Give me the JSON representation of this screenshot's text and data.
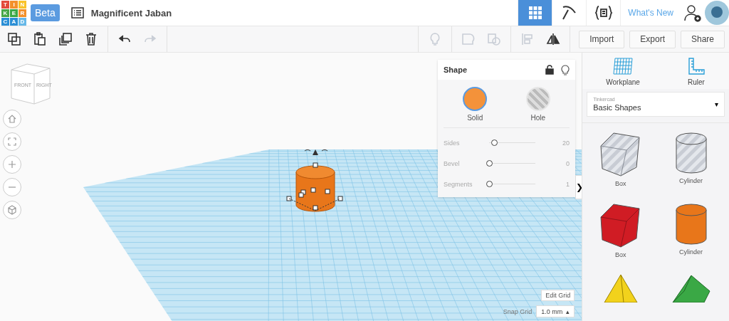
{
  "header": {
    "logo_letters": [
      "T",
      "I",
      "N",
      "K",
      "E",
      "R",
      "C",
      "A",
      "D"
    ],
    "badge": "Beta",
    "project_title": "Magnificent Jaban",
    "nav": [
      {
        "kind": "grid",
        "selected": true
      },
      {
        "kind": "pickaxe",
        "selected": false
      },
      {
        "kind": "code",
        "selected": false
      }
    ],
    "whats_new": "What's New"
  },
  "toolbar": {
    "left": [
      {
        "kind": "copy",
        "disabled": false
      },
      {
        "kind": "paste",
        "disabled": false
      },
      {
        "kind": "duplicate",
        "disabled": false
      },
      {
        "kind": "delete",
        "disabled": false
      },
      {
        "kind": "undo",
        "disabled": false
      },
      {
        "kind": "redo",
        "disabled": true
      }
    ],
    "right": [
      {
        "kind": "bulb",
        "disabled": true
      },
      {
        "kind": "group",
        "disabled": true
      },
      {
        "kind": "ungroup",
        "disabled": true
      },
      {
        "kind": "align",
        "disabled": true
      },
      {
        "kind": "mirror",
        "disabled": false
      }
    ],
    "buttons": [
      "Import",
      "Export",
      "Share"
    ]
  },
  "view_cube": {
    "front": "FRONT",
    "right": "RIGHT"
  },
  "view_controls": [
    {
      "kind": "home"
    },
    {
      "kind": "fit"
    },
    {
      "kind": "zoom-in"
    },
    {
      "kind": "zoom-out"
    },
    {
      "kind": "perspective"
    }
  ],
  "shape_panel": {
    "title": "Shape",
    "modes": [
      {
        "label": "Solid",
        "kind": "solid",
        "selected": true
      },
      {
        "label": "Hole",
        "kind": "hole",
        "selected": false
      }
    ],
    "sliders": [
      {
        "label": "Sides",
        "level": 0.1,
        "reading": "20"
      },
      {
        "label": "Bevel",
        "level": 0,
        "reading": "0"
      },
      {
        "label": "Segments",
        "level": 0,
        "reading": "1"
      }
    ],
    "collapse": "❯"
  },
  "grid_controls": {
    "edit_button": "Edit Grid",
    "snap_label": "Snap Grid",
    "snap_value": "1.0 mm",
    "snap_arrow": "▴"
  },
  "sidebar": {
    "tools": [
      {
        "kind": "workplane",
        "label": "Workplane"
      },
      {
        "kind": "ruler",
        "label": "Ruler"
      }
    ],
    "library": {
      "caption": "Tinkercad",
      "value": "Basic Shapes",
      "arrow": "▾"
    },
    "shapes": [
      {
        "kind": "box",
        "label": "Box",
        "color": "#c8ccd4",
        "hole": true
      },
      {
        "kind": "cylinder",
        "label": "Cylinder",
        "color": "#c8ccd4",
        "hole": true
      },
      {
        "kind": "box",
        "label": "Box",
        "color": "#d01c24",
        "hole": false
      },
      {
        "kind": "cylinder",
        "label": "Cylinder",
        "color": "#e8761a",
        "hole": false
      },
      {
        "kind": "pyramid",
        "color": "#f2d21c",
        "hole": false
      },
      {
        "kind": "roof",
        "color": "#3aa845",
        "hole": false
      }
    ]
  }
}
